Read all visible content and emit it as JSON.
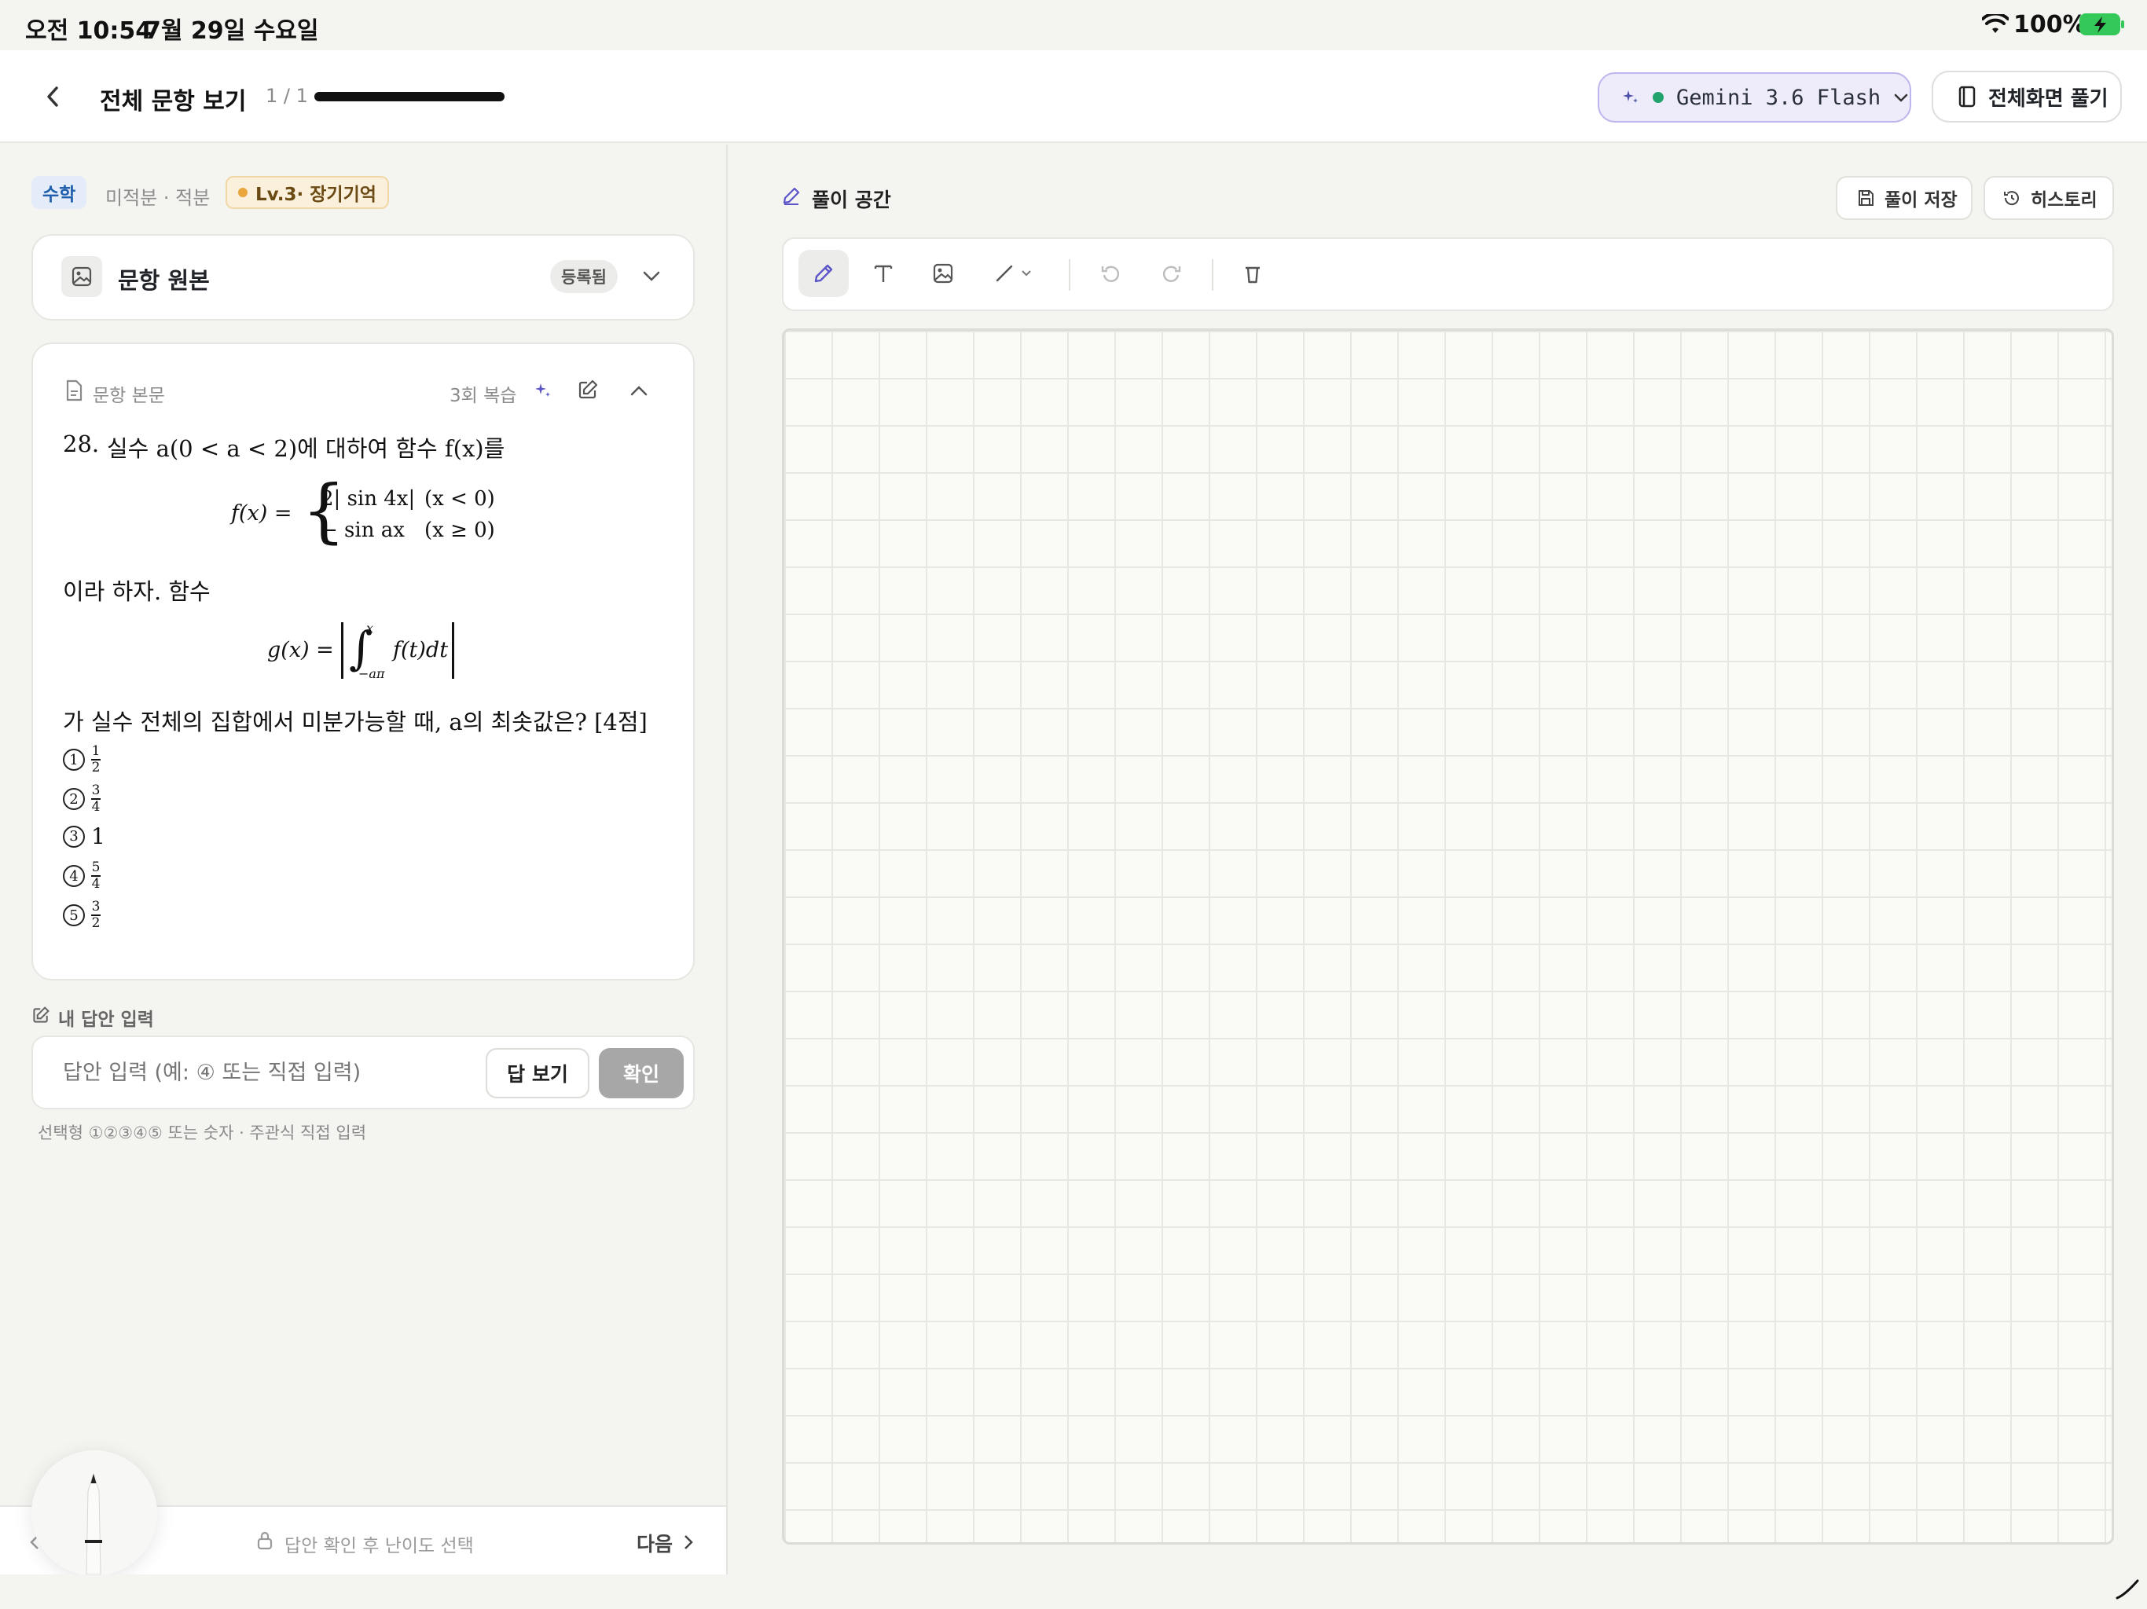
{
  "status_bar": {
    "time": "오전 10:54",
    "date": "7월 29일 수요일",
    "battery": "100%"
  },
  "header": {
    "title": "전체 문항 보기",
    "page_indicator": "1 / 1",
    "progress_fraction": 1.0,
    "model_label": "Gemini 3.6 Flash",
    "fullscreen_label": "전체화면 풀기"
  },
  "tags": {
    "subject": "수학",
    "topic": "미적분 · 적분",
    "level": "Lv.3· 장기기억"
  },
  "source_card": {
    "title": "문항 원본",
    "badge": "등록됨"
  },
  "problem": {
    "section_label": "문항 본문",
    "review_count": "3회 복습",
    "number": "28.",
    "intro": "실수 a(0 < a < 2)에 대하여 함수 f(x)를",
    "f_lhs": "f(x) =",
    "f_case1_expr": "2| sin 4x|",
    "f_case1_cond": "(x < 0)",
    "f_case2_expr": "− sin ax",
    "f_case2_cond": "(x ≥ 0)",
    "mid_text": "이라 하자. 함수",
    "g_lhs": "g(x) =",
    "g_upper": "x",
    "g_lower": "−aπ",
    "g_integrand": "f(t)dt",
    "question": "가 실수 전체의 집합에서 미분가능할 때, a의 최솟값은? [4점]",
    "choices": [
      {
        "mark": "1",
        "num": "1",
        "den": "2"
      },
      {
        "mark": "2",
        "num": "3",
        "den": "4"
      },
      {
        "mark": "3",
        "value": "1"
      },
      {
        "mark": "4",
        "num": "5",
        "den": "4"
      },
      {
        "mark": "5",
        "num": "3",
        "den": "2"
      }
    ]
  },
  "answer": {
    "section_label": "내 답안 입력",
    "placeholder": "답안 입력 (예: ④ 또는 직접 입력)",
    "show_answer_label": "답 보기",
    "confirm_label": "확인",
    "hint": "선택형 ①②③④⑤ 또는 숫자 · 주관식 직접 입력"
  },
  "footer": {
    "difficulty_hint": "답안 확인 후 난이도 선택",
    "next_label": "다음"
  },
  "workspace": {
    "title": "풀이 공간",
    "save_label": "풀이 저장",
    "history_label": "히스토리",
    "tools": [
      "pen-icon",
      "text-icon",
      "image-icon",
      "line-icon",
      "undo-icon",
      "redo-icon",
      "trash-icon"
    ]
  },
  "colors": {
    "accent": "#5b54c9",
    "model_status_dot": "#22a36b",
    "level_dot": "#e8a63c",
    "battery_green": "#34c759",
    "confirm_gray": "#a7a7a7"
  }
}
